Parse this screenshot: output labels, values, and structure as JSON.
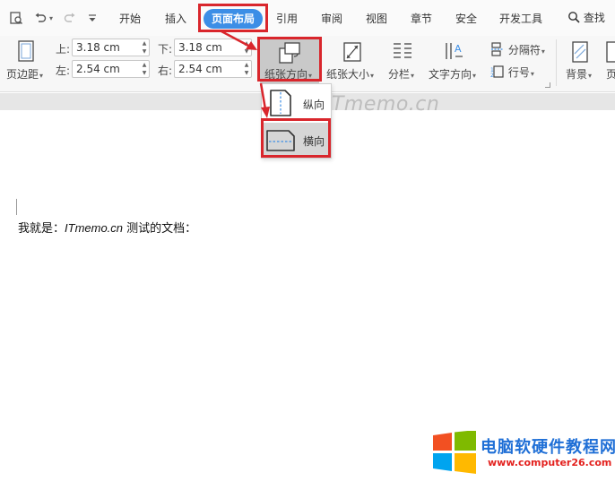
{
  "menu": {
    "items": [
      "开始",
      "插入",
      "页面布局",
      "引用",
      "审阅",
      "视图",
      "章节",
      "安全",
      "开发工具"
    ],
    "search_label": "查找"
  },
  "ribbon": {
    "margins_label": "页边距",
    "top_label": "上:",
    "top_value": "3.18 cm",
    "bottom_label": "下:",
    "bottom_value": "3.18 cm",
    "left_label": "左:",
    "left_value": "2.54 cm",
    "right_label": "右:",
    "right_value": "2.54 cm",
    "orientation_label": "纸张方向",
    "size_label": "纸张大小",
    "columns_label": "分栏",
    "text_direction_label": "文字方向",
    "breaks_label": "分隔符",
    "line_numbers_label": "行号",
    "background_label": "背景",
    "page_border_label": "页"
  },
  "orientation_menu": {
    "portrait": "纵向",
    "landscape": "横向"
  },
  "watermark": "ITmemo.cn",
  "document": {
    "prefix": "我就是：",
    "site": "ITmemo.cn",
    "suffix": " 测试的文档："
  },
  "logo": {
    "title": "电脑软硬件教程网",
    "url": "www.computer26.com"
  },
  "colors": {
    "accent": "#3c8ee6",
    "annotation_red": "#d9262c",
    "logo_blue": "#1f6fd6",
    "logo_red": "#e3211e"
  }
}
